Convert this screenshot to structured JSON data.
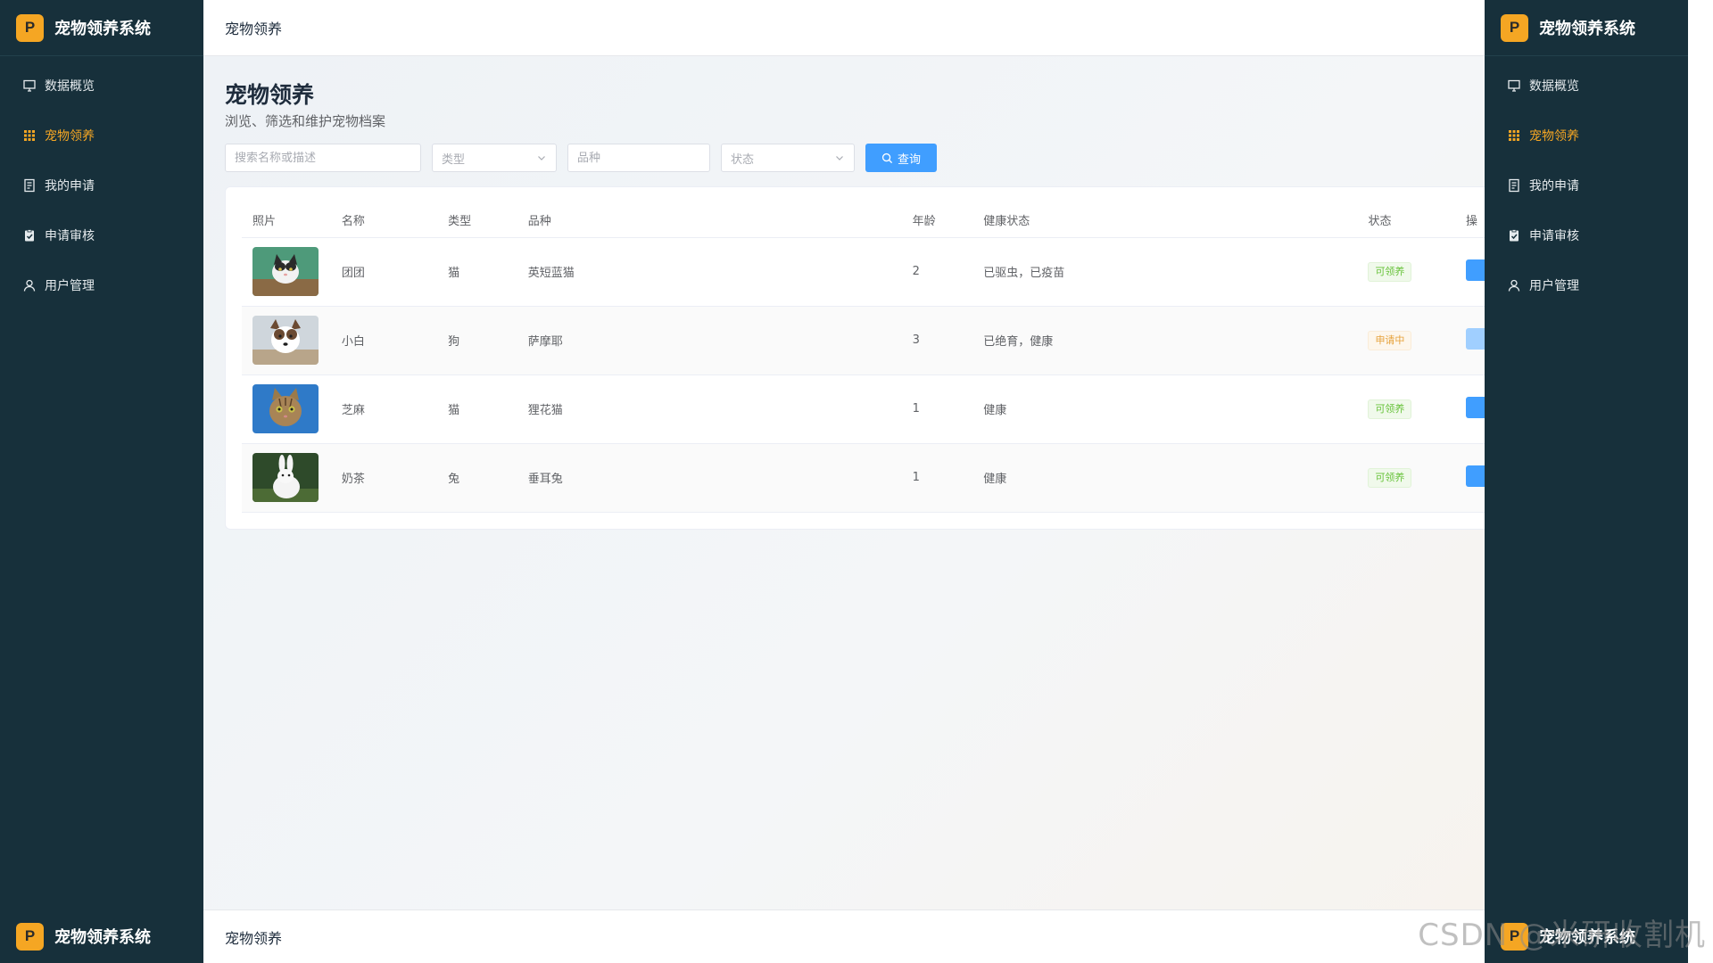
{
  "app": {
    "brand": "宠物领养系统",
    "logo_letter": "P"
  },
  "sidebar": {
    "items": [
      {
        "label": "数据概览",
        "icon": "monitor-icon",
        "active": false
      },
      {
        "label": "宠物领养",
        "icon": "grid-icon",
        "active": true
      },
      {
        "label": "我的申请",
        "icon": "document-icon",
        "active": false
      },
      {
        "label": "申请审核",
        "icon": "clipboard-check-icon",
        "active": false
      },
      {
        "label": "用户管理",
        "icon": "user-icon",
        "active": false
      }
    ]
  },
  "header": {
    "title": "宠物领养"
  },
  "page": {
    "title": "宠物领养",
    "subtitle": "浏览、筛选和维护宠物档案"
  },
  "filters": {
    "search_placeholder": "搜索名称或描述",
    "type_placeholder": "类型",
    "breed_placeholder": "品种",
    "status_placeholder": "状态",
    "query_label": "查询"
  },
  "table": {
    "columns": [
      "照片",
      "名称",
      "类型",
      "品种",
      "年龄",
      "健康状态",
      "状态",
      "操"
    ],
    "rows": [
      {
        "photo": "cat-photo",
        "name": "团团",
        "type": "猫",
        "breed": "英短蓝猫",
        "age": "2",
        "health": "已驱虫，已疫苗",
        "status": "可领养",
        "status_color": "#67c23a"
      },
      {
        "photo": "dog-photo",
        "name": "小白",
        "type": "狗",
        "breed": "萨摩耶",
        "age": "3",
        "health": "已绝育，健康",
        "status": "申请中",
        "status_color": "#e6a23c"
      },
      {
        "photo": "cat-photo",
        "name": "芝麻",
        "type": "猫",
        "breed": "狸花猫",
        "age": "1",
        "health": "健康",
        "status": "可领养",
        "status_color": "#67c23a"
      },
      {
        "photo": "rabbit-photo",
        "name": "奶茶",
        "type": "兔",
        "breed": "垂耳兔",
        "age": "1",
        "health": "健康",
        "status": "可领养",
        "status_color": "#67c23a"
      }
    ]
  },
  "footer": {
    "brand": "宠物领养系统",
    "title": "宠物领养"
  },
  "duplicate_panel": {
    "brand": "宠物领养系统",
    "items": [
      "数据概览",
      "宠物领养",
      "我的申请",
      "申请审核",
      "用户管理"
    ],
    "footer_brand": "宠物领养系统"
  },
  "watermark": "CSDN @米研收割机",
  "colors": {
    "sidebar_bg": "#17303b",
    "accent": "#f5a623",
    "primary": "#409eff"
  }
}
